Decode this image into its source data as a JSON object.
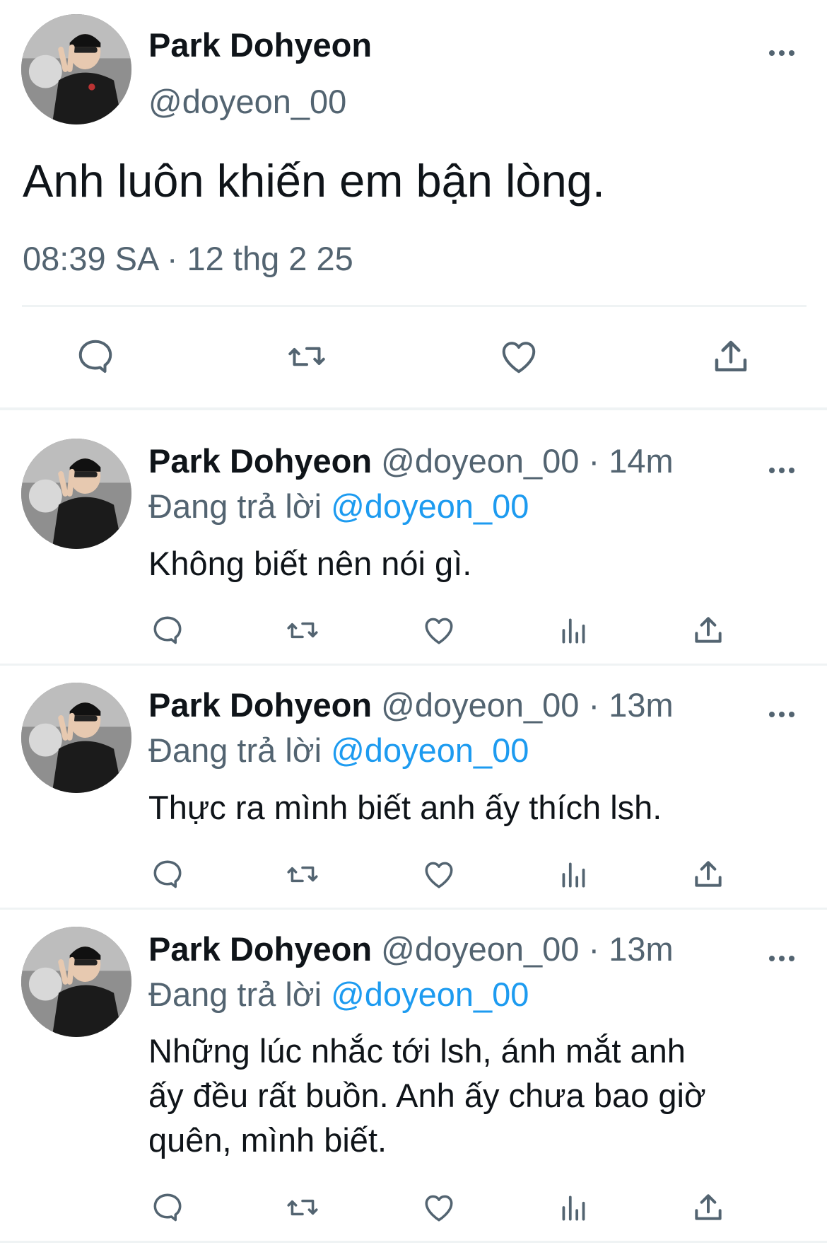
{
  "main_tweet": {
    "display_name": "Park Dohyeon",
    "handle": "@doyeon_00",
    "text": "Anh luôn khiến em bận lòng.",
    "timestamp": "08:39 SA · 12 thg 2 25",
    "more_icon": "more-horizontal-icon",
    "actions": [
      "reply-icon",
      "retweet-icon",
      "like-icon",
      "share-icon"
    ]
  },
  "replies": [
    {
      "display_name": "Park Dohyeon",
      "handle": "@doyeon_00",
      "time": "· 14m",
      "replying_label": "Đang trả lời",
      "replying_to": "@doyeon_00",
      "text": "Không biết nên nói gì."
    },
    {
      "display_name": "Park Dohyeon",
      "handle": "@doyeon_00",
      "time": "· 13m",
      "replying_label": "Đang trả lời",
      "replying_to": "@doyeon_00",
      "text": "Thực ra mình biết anh ấy thích lsh."
    },
    {
      "display_name": "Park Dohyeon",
      "handle": "@doyeon_00",
      "time": "· 13m",
      "replying_label": "Đang trả lời",
      "replying_to": "@doyeon_00",
      "text_lines": [
        "Những lúc nhắc tới lsh, ánh mắt anh",
        "ấy đều rất buồn. Anh ấy chưa bao giờ",
        "quên, mình biết."
      ]
    }
  ],
  "reply_actions": [
    "reply-icon",
    "retweet-icon",
    "like-icon",
    "views-icon",
    "share-icon"
  ],
  "colors": {
    "text": "#0f1419",
    "secondary": "#536471",
    "accent": "#1d9bf0",
    "divider": "#eff3f4"
  }
}
